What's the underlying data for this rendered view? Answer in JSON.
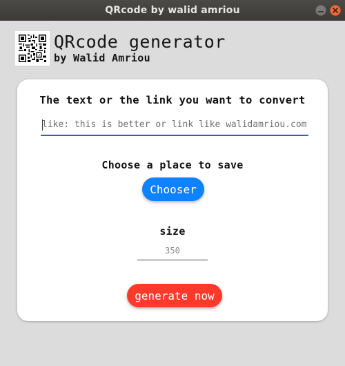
{
  "window": {
    "title": "QRcode by walid amriou",
    "controls": [
      "minimize-icon",
      "close-icon"
    ],
    "close_color": "#ef6a3a"
  },
  "header": {
    "logo_icon": "qr-code-icon",
    "title": "QRcode generator",
    "author": "by Walid Amriou"
  },
  "form": {
    "text_label": "The text or the link you want to convert",
    "text_placeholder": "like: this is better or link like walidamriou.com",
    "text_value": "",
    "place_label": "Choose a place to save",
    "chooser_label": "Chooser",
    "size_label": "size",
    "size_placeholder": "350",
    "size_value": "",
    "generate_label": "generate now"
  },
  "colors": {
    "chooser_button": "#0f82ff",
    "generate_button": "#ff3a2a",
    "input_underline": "#3f5fa8"
  }
}
